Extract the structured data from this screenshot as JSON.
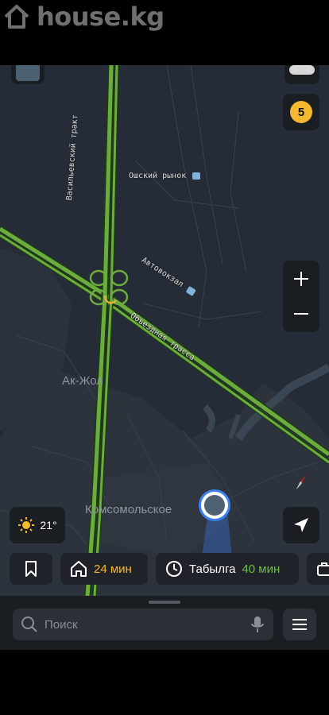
{
  "watermark": {
    "text": "house.kg"
  },
  "map": {
    "labels": {
      "vasilevsky": "Васильевский тракт",
      "osh_market": "Ошский рынок",
      "bus_station": "Автовокзал",
      "bypass": "Объездная трасса",
      "ak_zhol": "Ак-Жол",
      "komsomolskoe": "Комсомольское"
    },
    "colors": {
      "road": "#6cac3e",
      "map_bg": "#262c37",
      "accent_yellow": "#f5b82e",
      "location_blue": "#3d7ff0"
    }
  },
  "controls": {
    "badge_number": "5",
    "zoom_in_icon": "plus-icon",
    "zoom_out_icon": "minus-icon",
    "compass_icon": "compass-icon",
    "locate_icon": "navigation-arrow-icon"
  },
  "weather": {
    "temp": "21°",
    "icon": "sun-icon"
  },
  "chips": {
    "home_time": "24 мин",
    "work_name": "Табылга",
    "work_time": "40 мин"
  },
  "search": {
    "placeholder": "Поиск"
  }
}
